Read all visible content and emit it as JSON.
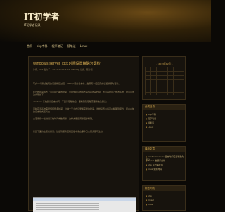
{
  "header": {
    "title": "IT初学者",
    "subtitle": "IT初学者记录"
  },
  "nav": {
    "items": [
      "首页",
      "php专科",
      "程序笔记",
      "随笔谈",
      "Linux"
    ]
  },
  "post": {
    "title": "windows server 日志时间设置精确为毫秒",
    "meta": "作者：dyk  发布于：2013-12-21 2:01  Tuesday  分类：服务器",
    "paragraphs": [
      "写文一个测试发现的问题修复过程，MSSQL服务日志中，发现有一段固定的设置精确为毫秒。",
      "在开始时间格式上设置有日期的时间，而服务默认的格式是保存的是秒级，所以需要自己修改系统，要设置更改步骤如下。",
      "windows 系统默认日志时间，不显示毫秒信息，要精确到毫秒需要修改注册表：",
      "某种存活系统需要保留很多时间，分钟一天之内记录着完整的时间，这样设置以后可以精确到毫秒，所以以前的日志格式还将会",
      "大事录和一些常用系统时间参数调整，这样方便您调整毫秒精确。",
      "修改下面的注册表键值，然后到服务控制面板中重启事件日志服务即可生效。"
    ]
  },
  "sidebar": {
    "calendar": {
      "title": "« 2013年12月 »"
    },
    "widgets": [
      {
        "head": "分类目录",
        "items": [
          "php专科",
          "程序笔记",
          "随笔谈",
          "Linux"
        ]
      },
      {
        "head": "最新文章",
        "items": [
          "windows server 日志时间设置精确为毫秒",
          "mysql 数据库备份",
          "php 字符串处理",
          "linux 常用命令"
        ]
      },
      {
        "head": "标签列表",
        "items": [
          "php",
          "mysql",
          "linux"
        ]
      }
    ]
  }
}
